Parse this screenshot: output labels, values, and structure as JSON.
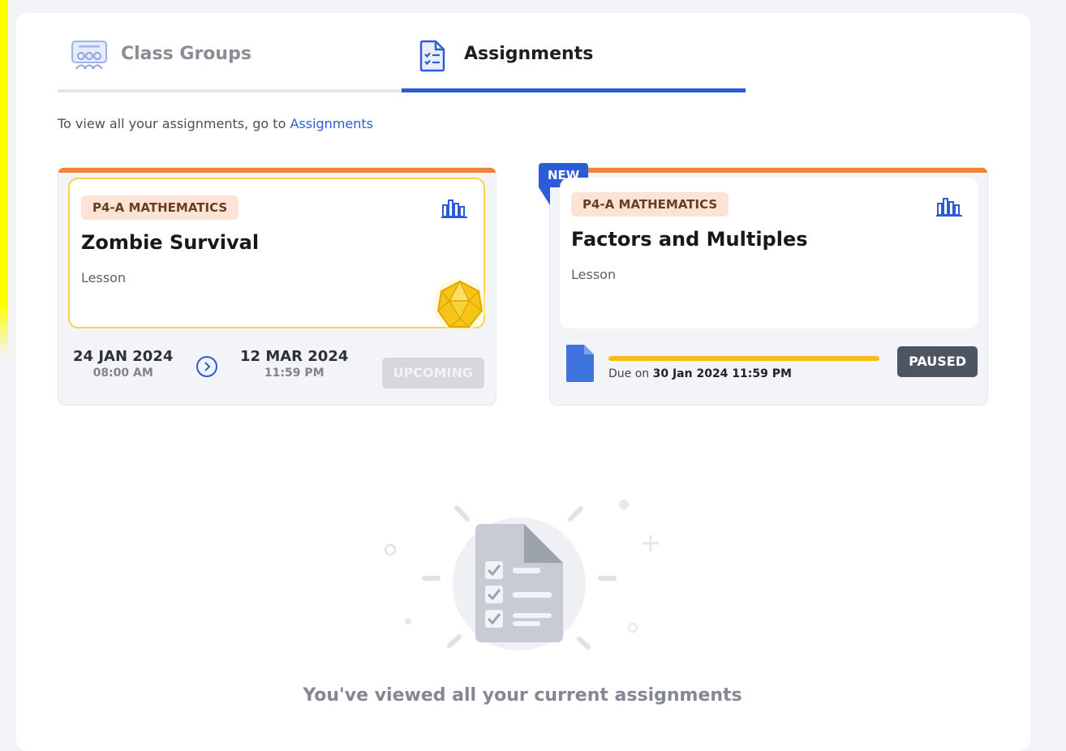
{
  "tabs": [
    {
      "label": "Class Groups",
      "icon": "class-group-icon",
      "active": false
    },
    {
      "label": "Assignments",
      "icon": "assignment-list-icon",
      "active": true
    }
  ],
  "hint": {
    "text": "To view all your assignments, go to ",
    "link": "Assignments"
  },
  "cards": [
    {
      "subject": "P4-A MATHEMATICS",
      "title": "Zombie Survival",
      "type": "Lesson",
      "start_date": "24 JAN 2024",
      "start_time": "08:00 AM",
      "end_date": "12 MAR 2024",
      "end_time": "11:59 PM",
      "status": "UPCOMING",
      "icon": "chart-icon"
    },
    {
      "badge": "NEW",
      "subject": "P4-A MATHEMATICS",
      "title": "Factors and Multiples",
      "type": "Lesson",
      "due_prefix": "Due on ",
      "due_date": "30 Jan 2024 11:59 PM",
      "progress": 1.0,
      "status": "PAUSED",
      "icon": "chart-icon"
    }
  ],
  "empty_state": {
    "text": "You've viewed all your current assignments",
    "icon": "checklist-document-icon"
  },
  "colors": {
    "accent": "#2c5bd7",
    "card_top": "#ef8539",
    "progress": "#f6bd15",
    "tag_bg": "#fbe4d5"
  }
}
